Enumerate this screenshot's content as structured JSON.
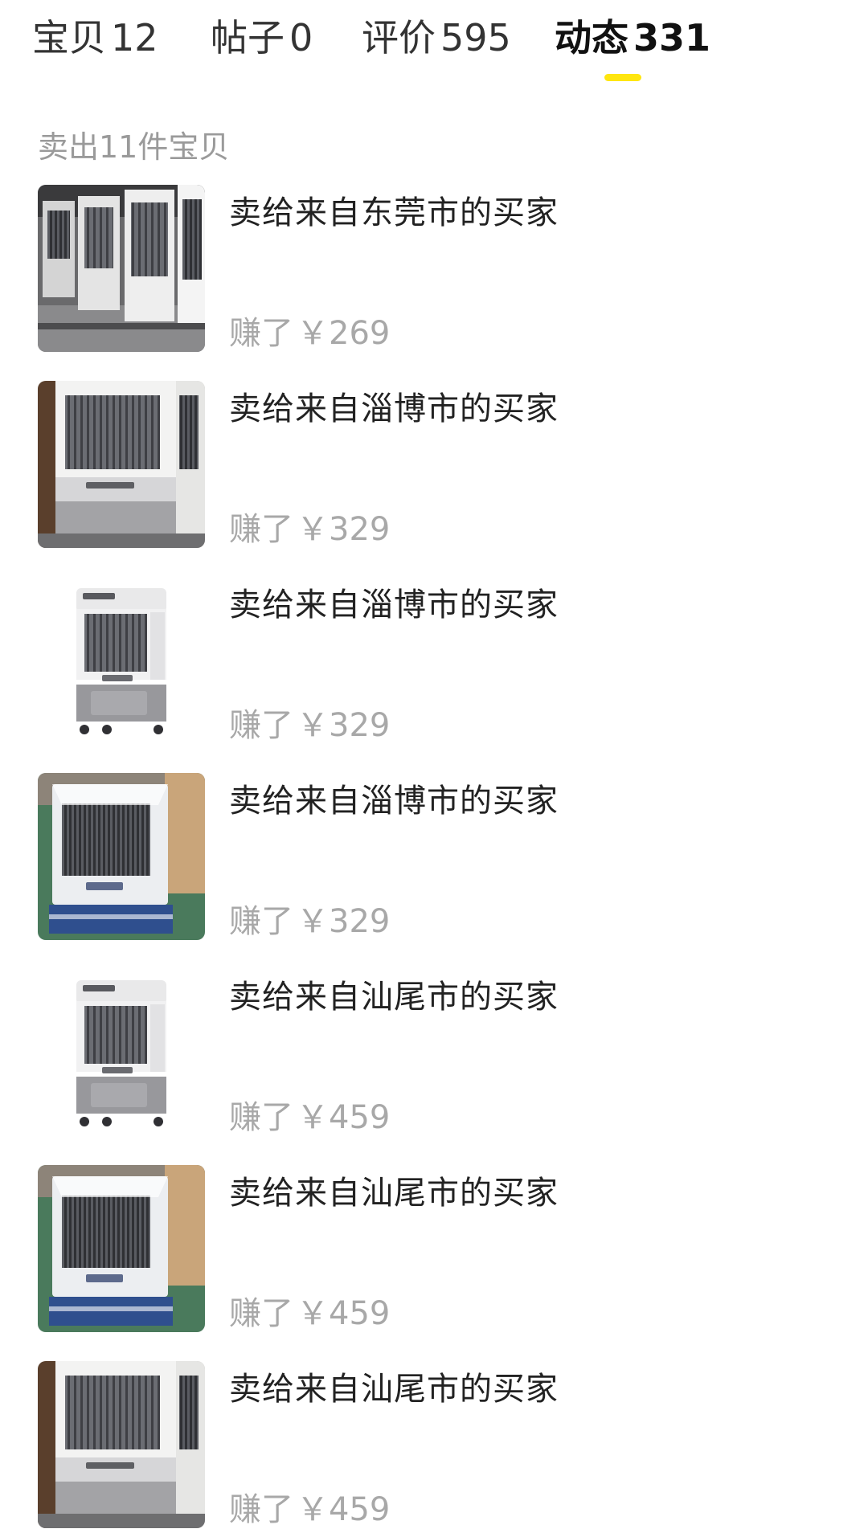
{
  "tabs": [
    {
      "label": "宝贝",
      "count": "12",
      "active": false
    },
    {
      "label": "帖子",
      "count": "0",
      "active": false
    },
    {
      "label": "评价",
      "count": "595",
      "active": false
    },
    {
      "label": "动态",
      "count": "331",
      "active": true
    }
  ],
  "colors": {
    "accent": "#ffe60f",
    "muted": "#a8a8a8",
    "text": "#222222"
  },
  "summary": "卖出11件宝贝",
  "sales": [
    {
      "title": "卖给来自东莞市的买家",
      "earned_label": "赚了",
      "price": "￥269",
      "image": "air-cooler-warehouse-row-photo"
    },
    {
      "title": "卖给来自淄博市的买家",
      "earned_label": "赚了",
      "price": "￥329",
      "image": "air-cooler-closeup-photo"
    },
    {
      "title": "卖给来自淄博市的买家",
      "earned_label": "赚了",
      "price": "￥329",
      "image": "air-cooler-product-photo"
    },
    {
      "title": "卖给来自淄博市的买家",
      "earned_label": "赚了",
      "price": "￥329",
      "image": "air-cooler-wrapped-photo"
    },
    {
      "title": "卖给来自汕尾市的买家",
      "earned_label": "赚了",
      "price": "￥459",
      "image": "air-cooler-product-photo"
    },
    {
      "title": "卖给来自汕尾市的买家",
      "earned_label": "赚了",
      "price": "￥459",
      "image": "air-cooler-wrapped-photo"
    },
    {
      "title": "卖给来自汕尾市的买家",
      "earned_label": "赚了",
      "price": "￥459",
      "image": "air-cooler-closeup-photo"
    }
  ]
}
